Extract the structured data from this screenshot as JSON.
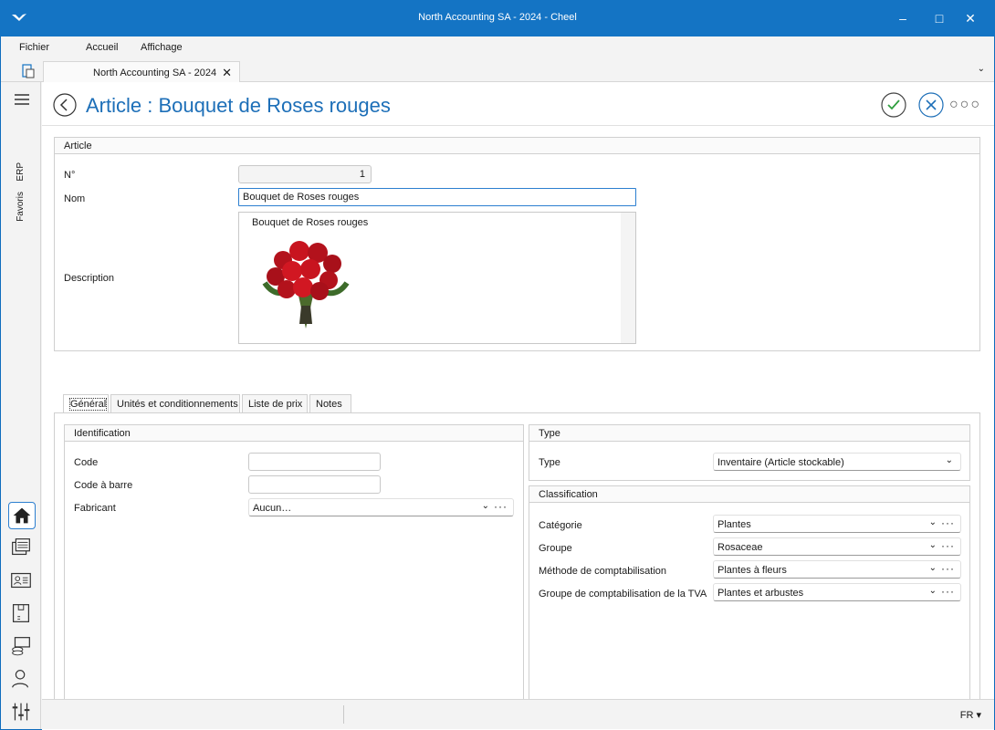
{
  "window": {
    "title": "North Accounting SA - 2024 - Cheel"
  },
  "menu": {
    "items": [
      "Fichier",
      "Accueil",
      "Affichage"
    ]
  },
  "doc_tab": {
    "label": "North Accounting SA - 2024"
  },
  "sidebar": {
    "erp": "ERP",
    "favoris": "Favoris"
  },
  "header": {
    "title": "Article : Bouquet de Roses rouges"
  },
  "article": {
    "group_title": "Article",
    "no_label": "N°",
    "no_value": "1",
    "name_label": "Nom",
    "name_value": "Bouquet de Roses rouges",
    "desc_label": "Description",
    "desc_text": "Bouquet de Roses rouges"
  },
  "tabs": [
    "Général",
    "Unités et conditionnements",
    "Liste de prix",
    "Notes"
  ],
  "identification": {
    "title": "Identification",
    "code_label": "Code",
    "code_value": "",
    "barcode_label": "Code à barre",
    "barcode_value": "",
    "maker_label": "Fabricant",
    "maker_value": "Aucun…"
  },
  "type": {
    "title": "Type",
    "type_label": "Type",
    "type_value": "Inventaire (Article stockable)"
  },
  "classification": {
    "title": "Classification",
    "rows": [
      {
        "label": "Catégorie",
        "value": "Plantes"
      },
      {
        "label": "Groupe",
        "value": "Rosaceae"
      },
      {
        "label": "Méthode de comptabilisation",
        "value": "Plantes à fleurs"
      },
      {
        "label": "Groupe de comptabilisation de la TVA",
        "value": "Plantes et arbustes"
      }
    ]
  },
  "status": {
    "lang": "FR"
  },
  "colors": {
    "accent": "#1474c4",
    "title_blue": "#1d6fb8",
    "confirm_green": "#2e9e3e"
  }
}
